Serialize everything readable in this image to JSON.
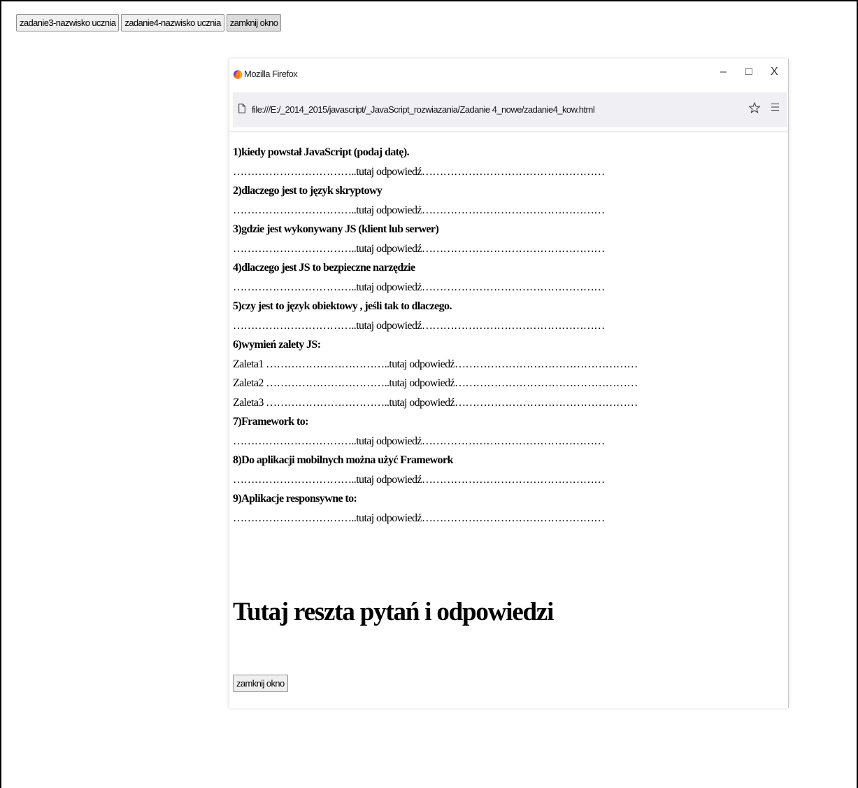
{
  "top_buttons": [
    {
      "label": "zadanie3-nazwisko ucznia"
    },
    {
      "label": "zadanie4-nazwisko ucznia"
    },
    {
      "label": "zamknij okno"
    }
  ],
  "popup": {
    "title": "Mozilla Firefox",
    "controls": {
      "minimize": "–",
      "maximize": "□",
      "close": "X"
    },
    "url": "file:///E:/_2014_2015/javascript/_JavaScript_rozwiazania/Zadanie 4_nowe/zadanie4_kow.html"
  },
  "content": {
    "answer_line": "……………………………..tutaj odpowiedź……………………………………………",
    "questions": [
      {
        "question": "1)kiedy powstał JavaScript (podaj datę)."
      },
      {
        "question": "2)dlaczego jest to język skryptowy"
      },
      {
        "question": "3)gdzie jest wykonywany JS (klient lub serwer)"
      },
      {
        "question": "4)dlaczego jest JS to bezpieczne narzędzie"
      },
      {
        "question": "5)czy jest to język obiektowy , jeśli tak to dlaczego."
      },
      {
        "question": "6)wymień zalety JS:"
      },
      {
        "question": "7)Framework to:"
      },
      {
        "question": "8)Do aplikacji mobilnych można użyć Framework"
      },
      {
        "question": "9)Aplikacje responsywne to:"
      }
    ],
    "advantages": [
      "Zaleta1 ……………………………..tutaj odpowiedź……………………………………………",
      "Zaleta2 ……………………………..tutaj odpowiedź……………………………………………",
      "Zaleta3 ……………………………..tutaj odpowiedź……………………………………………"
    ],
    "heading": "Tutaj reszta pytań i odpowiedzi",
    "close_button": "zamknij okno"
  }
}
